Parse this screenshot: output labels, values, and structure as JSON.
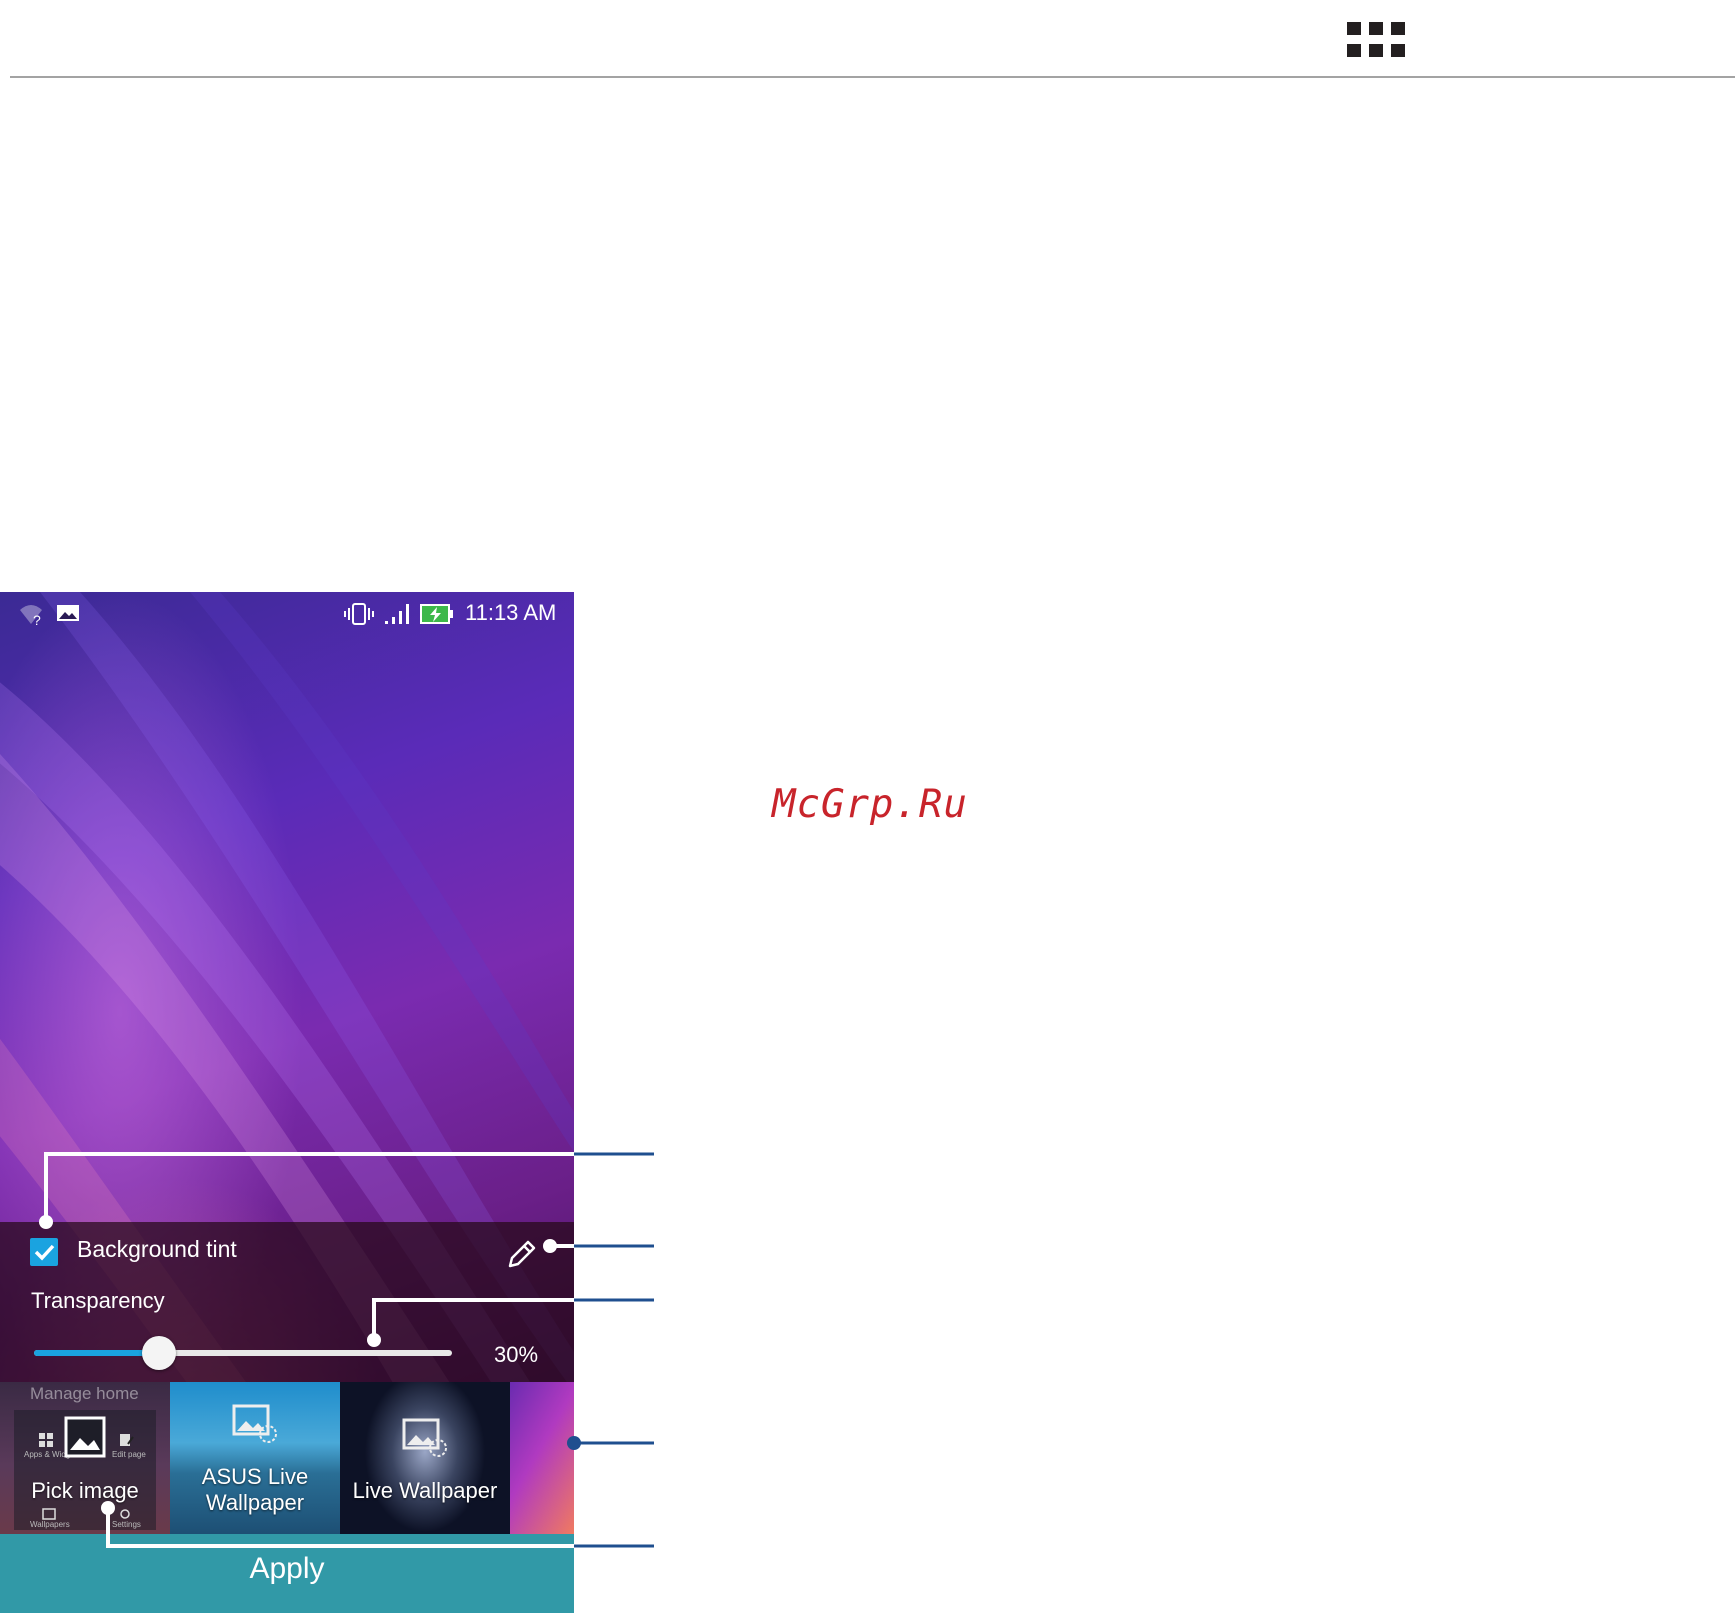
{
  "phone": {
    "status_bar": {
      "time": "11:13 AM"
    },
    "tint_panel": {
      "background_tint_label": "Background tint",
      "background_tint_checked": true,
      "transparency_label": "Transparency",
      "transparency_value_text": "30%",
      "transparency_level": 0.3
    },
    "picker": {
      "manage_home_label": "Manage home",
      "mini_labels": [
        "Apps & Widg",
        "Edit page",
        "Wallpapers",
        "Settings"
      ],
      "tiles": [
        {
          "label": "Pick image"
        },
        {
          "label_line1": "ASUS Live",
          "label_line2": "Wallpaper"
        },
        {
          "label": "Live Wallpaper"
        }
      ]
    },
    "apply_label": "Apply"
  },
  "watermark": "McGrp.Ru",
  "colors": {
    "accent_blue": "#1aa3e0",
    "apply_bar": "#3199a7",
    "callout_line": "#1f4f8f",
    "watermark_red": "#c8242b"
  }
}
